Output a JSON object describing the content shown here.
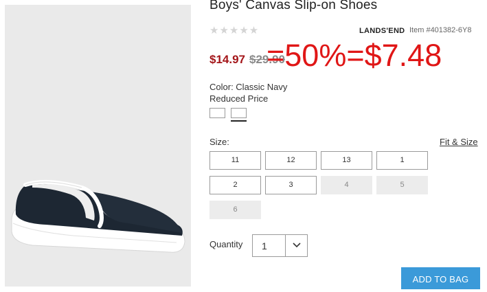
{
  "product": {
    "title": "Boys' Canvas Slip-on Shoes",
    "rating_stars": "★★★★★",
    "brand": "LANDS'END",
    "item_number": "Item #401382-6Y8"
  },
  "pricing": {
    "sale_price": "$14.97",
    "original_price": "$29.90",
    "promo_overlay": "=50%=$7.48"
  },
  "color": {
    "label": "Color: Classic Navy",
    "price_note": "Reduced Price"
  },
  "size": {
    "label": "Size:",
    "fit_link": "Fit & Size",
    "options": [
      "11",
      "12",
      "13",
      "1",
      "2",
      "3",
      "4",
      "5",
      "6"
    ]
  },
  "quantity": {
    "label": "Quantity",
    "value": "1"
  },
  "actions": {
    "add_to_bag": "ADD TO BAG"
  },
  "colors": {
    "sale_red": "#a4161a",
    "promo_red": "#e01616",
    "button_blue": "#3b9ad9"
  }
}
